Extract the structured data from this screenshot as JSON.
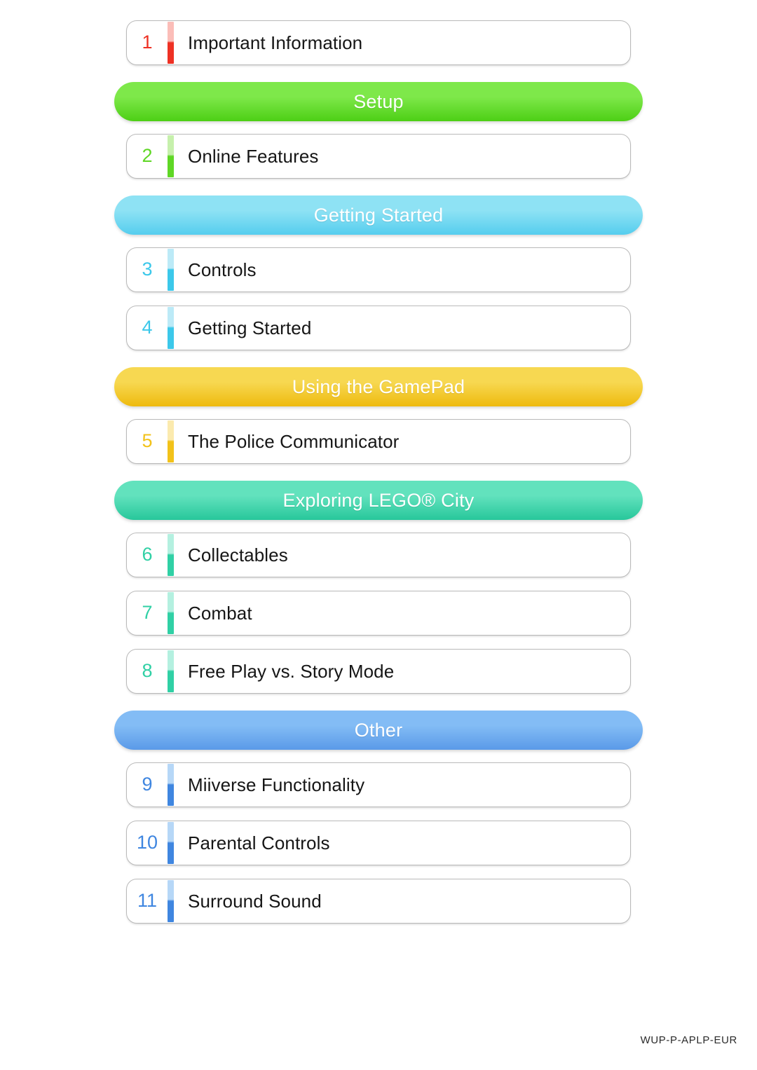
{
  "document": {
    "type": "electronic-manual-table-of-contents",
    "product_code": "WUP-P-APLP-EUR"
  },
  "palette": {
    "red": "#ee3124",
    "red_light": "#fbbdb8",
    "green": "#5fd725",
    "green_light": "#c6f0ac",
    "green_header_top": "#7ee84a",
    "green_header_bottom": "#4dcf15",
    "cyan": "#3cc8ea",
    "cyan_light": "#bceaf7",
    "cyan_header_top": "#8ee2f4",
    "cyan_header_bottom": "#55cdee",
    "yellow": "#f2c21a",
    "yellow_light": "#fbeaae",
    "yellow_header_top": "#f7d851",
    "yellow_header_bottom": "#eeba0e",
    "teal": "#30d0a5",
    "teal_light": "#b4f0e0",
    "teal_header_top": "#62e2bd",
    "teal_header_bottom": "#27c79b",
    "blue": "#3f86e0",
    "blue_light": "#b6d7f7",
    "blue_header_top": "#83bcf5",
    "blue_header_bottom": "#5a9ae8",
    "text": "#161616",
    "border": "#b9b9b9"
  },
  "sections": [
    {
      "id": "intro",
      "header": null,
      "entries": [
        {
          "number": "1",
          "label": "Important Information",
          "color_key": "red"
        }
      ]
    },
    {
      "id": "setup",
      "header": {
        "label": "Setup",
        "color_key": "green"
      },
      "entries": [
        {
          "number": "2",
          "label": "Online Features",
          "color_key": "green"
        }
      ]
    },
    {
      "id": "getting-started",
      "header": {
        "label": "Getting Started",
        "color_key": "cyan"
      },
      "entries": [
        {
          "number": "3",
          "label": "Controls",
          "color_key": "cyan"
        },
        {
          "number": "4",
          "label": "Getting Started",
          "color_key": "cyan"
        }
      ]
    },
    {
      "id": "using-the-gamepad",
      "header": {
        "label": "Using the GamePad",
        "color_key": "yellow"
      },
      "entries": [
        {
          "number": "5",
          "label": "The Police Communicator",
          "color_key": "yellow"
        }
      ]
    },
    {
      "id": "exploring-lego-city",
      "header": {
        "label": "Exploring LEGO® City",
        "color_key": "teal"
      },
      "entries": [
        {
          "number": "6",
          "label": "Collectables",
          "color_key": "teal"
        },
        {
          "number": "7",
          "label": "Combat",
          "color_key": "teal"
        },
        {
          "number": "8",
          "label": "Free Play vs. Story Mode",
          "color_key": "teal"
        }
      ]
    },
    {
      "id": "other",
      "header": {
        "label": "Other",
        "color_key": "blue"
      },
      "entries": [
        {
          "number": "9",
          "label": "Miiverse Functionality",
          "color_key": "blue"
        },
        {
          "number": "10",
          "label": "Parental Controls",
          "color_key": "blue"
        },
        {
          "number": "11",
          "label": "Surround Sound",
          "color_key": "blue"
        }
      ]
    }
  ]
}
